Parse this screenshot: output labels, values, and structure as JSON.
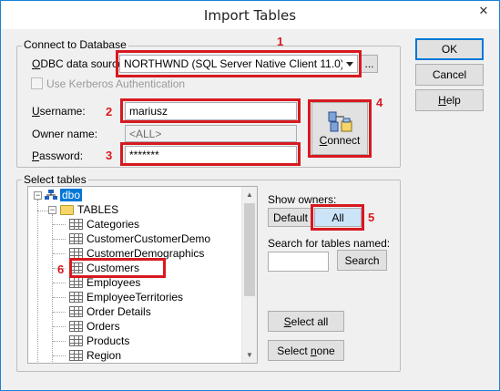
{
  "window": {
    "title": "Import Tables",
    "close_glyph": "✕"
  },
  "side_buttons": {
    "ok": "OK",
    "cancel": "Cancel",
    "help": "Help"
  },
  "connect_group": {
    "label": "Connect to Database",
    "odbc_label": "ODBC data source:",
    "odbc_value": "NORTHWND (SQL Server Native Client 11.0)",
    "browse_label": "...",
    "kerberos_label": "Use Kerberos Authentication",
    "username_label": "Username:",
    "username_value": "mariusz",
    "owner_label": "Owner name:",
    "owner_value": "<ALL>",
    "password_label": "Password:",
    "password_value": "*******",
    "connect_label": "Connect"
  },
  "tables_group": {
    "label": "Select tables",
    "root": "dbo",
    "folder": "TABLES",
    "tables": [
      "Categories",
      "CustomerCustomerDemo",
      "CustomerDemographics",
      "Customers",
      "Employees",
      "EmployeeTerritories",
      "Order Details",
      "Orders",
      "Products",
      "Region"
    ],
    "show_owners_label": "Show owners:",
    "default_label": "Default",
    "all_label": "All",
    "search_label": "Search for tables named:",
    "search_value": "",
    "search_button": "Search",
    "select_all": "Select all",
    "select_none": "Select none"
  },
  "annotations": [
    "1",
    "2",
    "3",
    "4",
    "5",
    "6"
  ],
  "colors": {
    "highlight": "#d71920",
    "selection": "#0078d7"
  }
}
